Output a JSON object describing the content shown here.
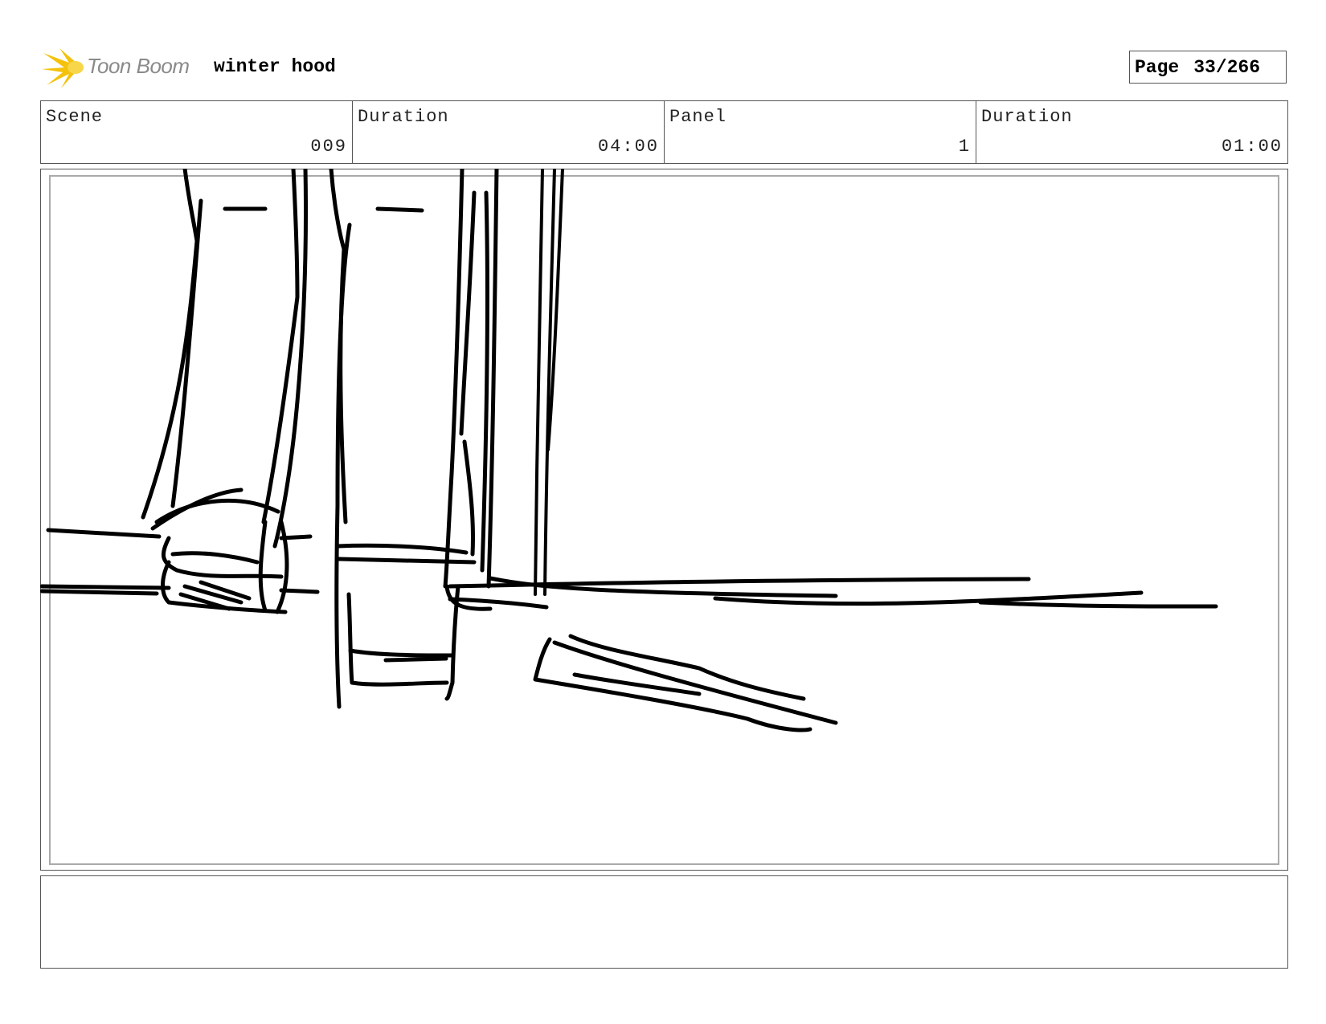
{
  "header": {
    "logo_text": "Toon Boom",
    "project_title": "winter hood",
    "page_label": "Page",
    "page_value": "33/266"
  },
  "info": {
    "scene_label": "Scene",
    "scene_value": "009",
    "scene_duration_label": "Duration",
    "scene_duration_value": "04:00",
    "panel_label": "Panel",
    "panel_value": "1",
    "panel_duration_label": "Duration",
    "panel_duration_value": "01:00"
  },
  "panel_image": {
    "icon": "rough-sketch-legs-and-floor"
  },
  "notes": {
    "text": ""
  },
  "colors": {
    "logo_star": "#f4c20d",
    "logo_text": "#8a8a8a",
    "border": "#555555",
    "inner_frame": "#aaaaaa"
  }
}
